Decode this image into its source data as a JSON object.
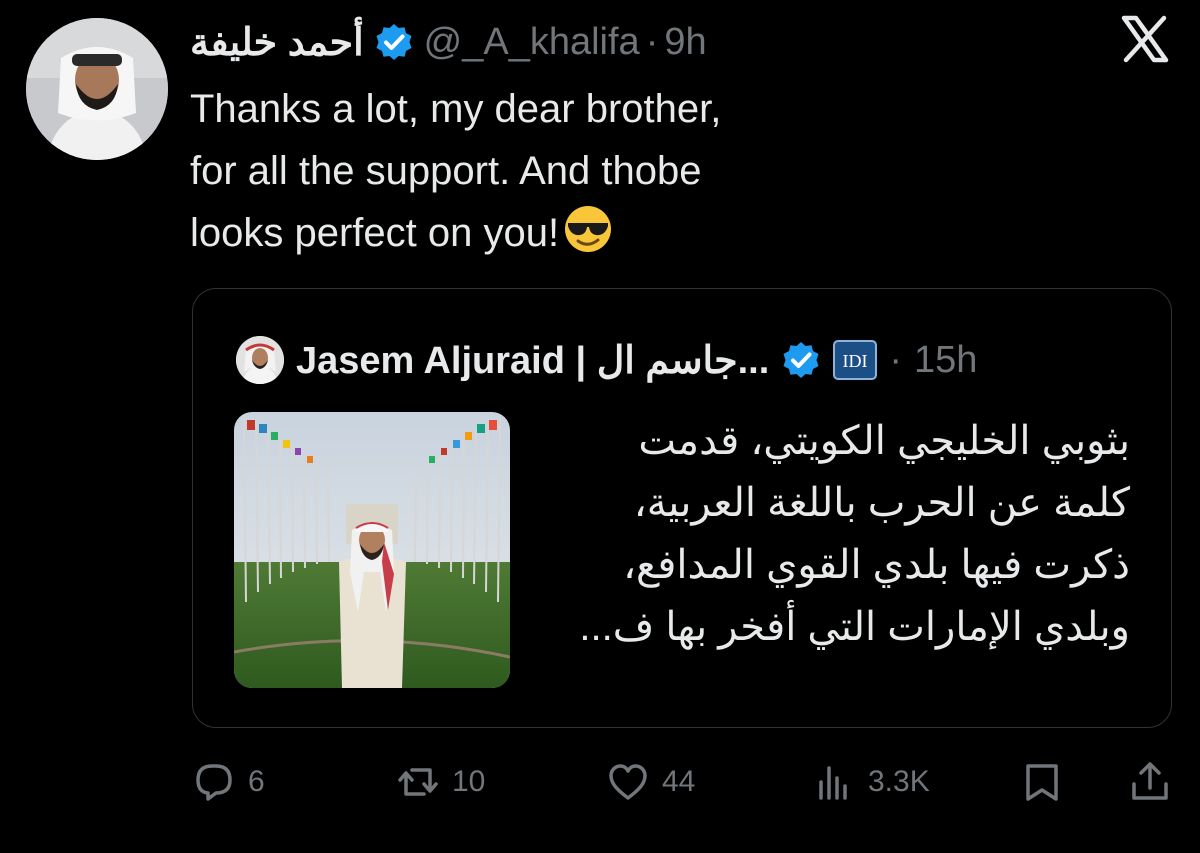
{
  "tweet": {
    "author_name": "أحمد خليفة",
    "handle": "@_A_khalifa",
    "separator": "·",
    "time": "9h",
    "text_lines": [
      "Thanks a lot, my dear brother,",
      "for all the support. And  thobe",
      "looks perfect on you!"
    ],
    "emoji": "smiling-face-with-sunglasses"
  },
  "quote": {
    "author_name": "Jasem Aljuraid | جاسم ال...",
    "affiliation_badge": "IDI",
    "separator": "·",
    "time": "15h",
    "text_lines": [
      "بثوبي الخليجي الكويتي، قدمت",
      "كلمة عن الحرب باللغة العربية،",
      "ذكرت فيها بلدي القوي المدافع،",
      "وبلدي الإمارات التي أفخر بها ف..."
    ]
  },
  "actions": {
    "replies": "6",
    "reposts": "10",
    "likes": "44",
    "views": "3.3K"
  },
  "colors": {
    "background": "#000000",
    "text": "#e7e9ea",
    "secondary": "#71767b",
    "verified": "#1d9bf0",
    "border": "#2f3336"
  }
}
